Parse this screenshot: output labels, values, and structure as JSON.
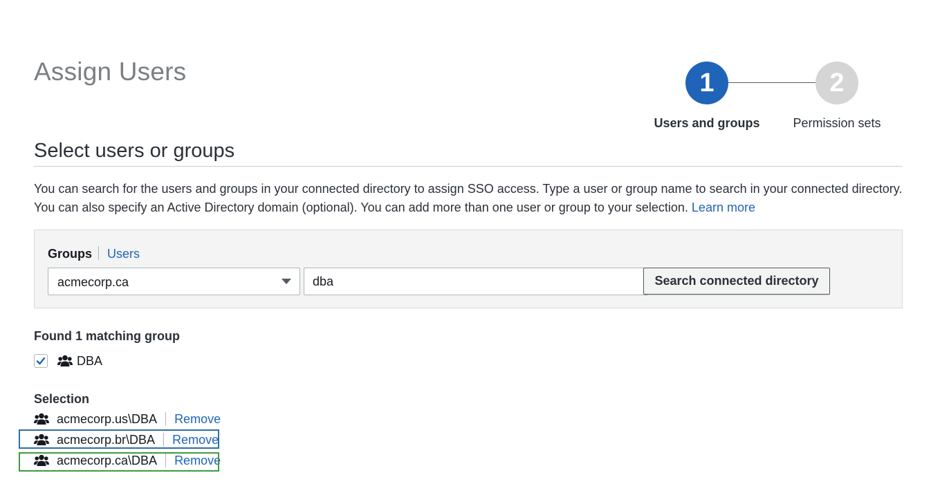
{
  "page": {
    "title": "Assign Users"
  },
  "stepper": {
    "steps": [
      {
        "number": "1",
        "label": "Users and groups",
        "state": "active"
      },
      {
        "number": "2",
        "label": "Permission sets",
        "state": "inactive"
      }
    ]
  },
  "section": {
    "title": "Select users or groups",
    "description_line1": "You can search for the users and groups in your connected directory to assign SSO access. Type a user or group name to search in your connected directory.",
    "description_line2": "You can also specify an Active Directory domain (optional). You can add more than one user or group to your selection.",
    "learn_more": "Learn more"
  },
  "search": {
    "tabs": [
      {
        "label": "Groups",
        "selected": true
      },
      {
        "label": "Users",
        "selected": false
      }
    ],
    "domain": "acmecorp.ca",
    "query": "dba",
    "button_label": "Search connected directory"
  },
  "results": {
    "heading": "Found 1 matching group",
    "items": [
      {
        "name": "DBA",
        "checked": true,
        "icon": "group-icon"
      }
    ]
  },
  "selection": {
    "heading": "Selection",
    "remove_label": "Remove",
    "items": [
      {
        "name": "acmecorp.us\\DBA",
        "icon": "group-icon"
      },
      {
        "name": "acmecorp.br\\DBA",
        "icon": "group-icon",
        "highlight": "blue"
      },
      {
        "name": "acmecorp.ca\\DBA",
        "icon": "group-icon",
        "highlight": "green"
      }
    ]
  },
  "colors": {
    "accent": "#1f64b8",
    "step_inactive": "#d5d5d5",
    "highlight_blue": "#2c6fa3",
    "highlight_green": "#3f9a3f"
  }
}
